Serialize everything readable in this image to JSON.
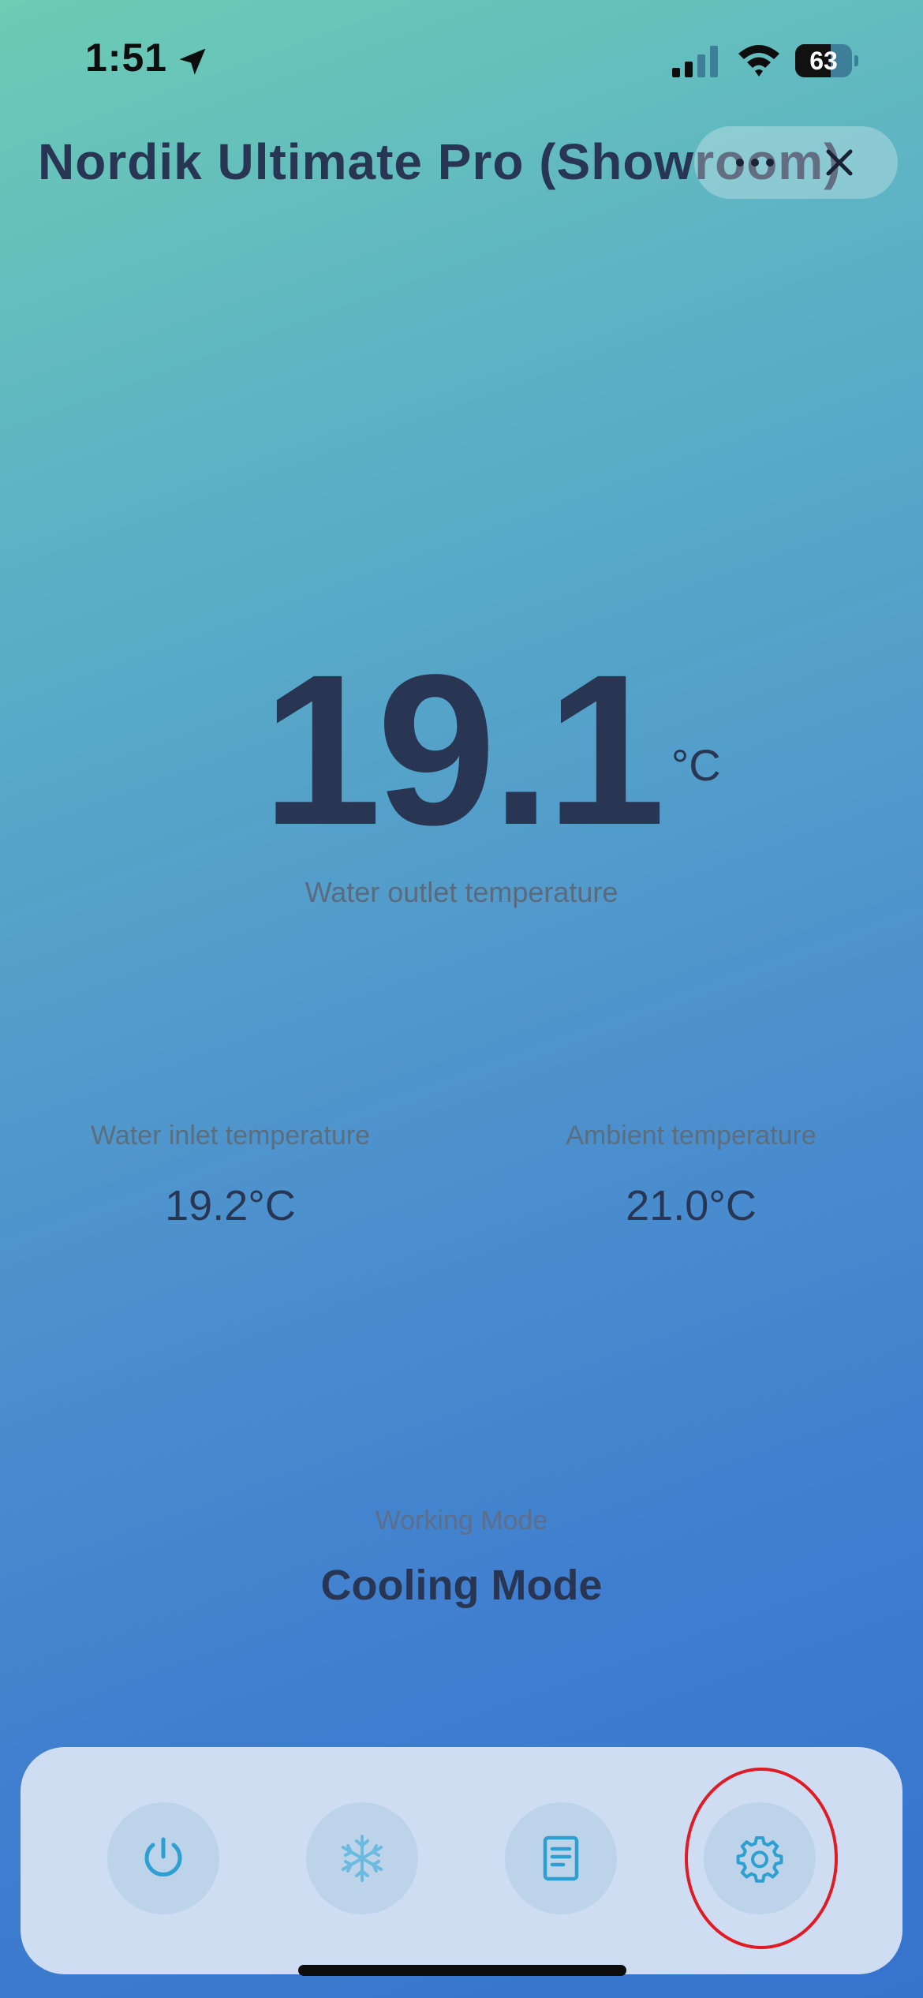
{
  "status_bar": {
    "time": "1:51",
    "battery": "63",
    "battery_level": 0.63
  },
  "header": {
    "title": "Nordik Ultimate Pro (Showroom)"
  },
  "main": {
    "outlet_temp": "19.1",
    "outlet_unit": "°C",
    "outlet_label": "Water outlet temperature"
  },
  "stats": [
    {
      "label": "Water inlet temperature",
      "value": "19.2°C"
    },
    {
      "label": "Ambient temperature",
      "value": "21.0°C"
    }
  ],
  "mode": {
    "label": "Working Mode",
    "value": "Cooling Mode"
  },
  "toolbar": {
    "buttons": [
      {
        "icon": "power-icon"
      },
      {
        "icon": "snowflake-icon"
      },
      {
        "icon": "document-icon"
      },
      {
        "icon": "gear-icon"
      }
    ],
    "highlighted_button": "settings"
  },
  "colors": {
    "text_primary": "#283654",
    "text_secondary": "#5b6e7e",
    "icon_accent": "#2d9fd0",
    "toolbar_bg": "#cfddf3",
    "highlight": "#e01b24"
  }
}
